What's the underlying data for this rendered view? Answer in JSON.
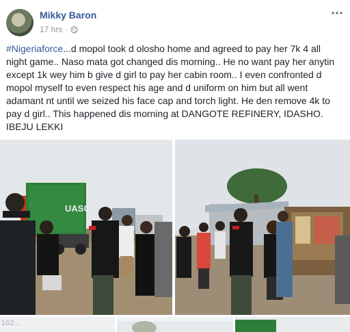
{
  "post": {
    "author": "Mikky Baron",
    "time": "17 hrs",
    "separator": "·",
    "privacy_icon": "globe-icon",
    "more_icon": "more-options-icon",
    "hashtag": "#Nigeriaforce",
    "text": "...d mopol took d olosho home and agreed to pay her 7k 4 all night game.. Naso mata got changed dis morning.. He no want pay her anytin except 1k wey him b give d girl to pay her cabin room.. I even confronted d mopol myself to even respect his age and d uniform on him but all went adamant nt until we seized his face cap and torch light. He den remove 4k to pay d girl.. This happened dis morning at DANGOTE REFINERY, IDASHO. IBEJU LEKKI"
  },
  "photos": {
    "count_label": "162...",
    "colors": {
      "link": "#365899",
      "meta": "#90949c",
      "container": "#2f7d3a",
      "truck_cab": "#c0391b",
      "sky": "#dfe3e7"
    }
  }
}
